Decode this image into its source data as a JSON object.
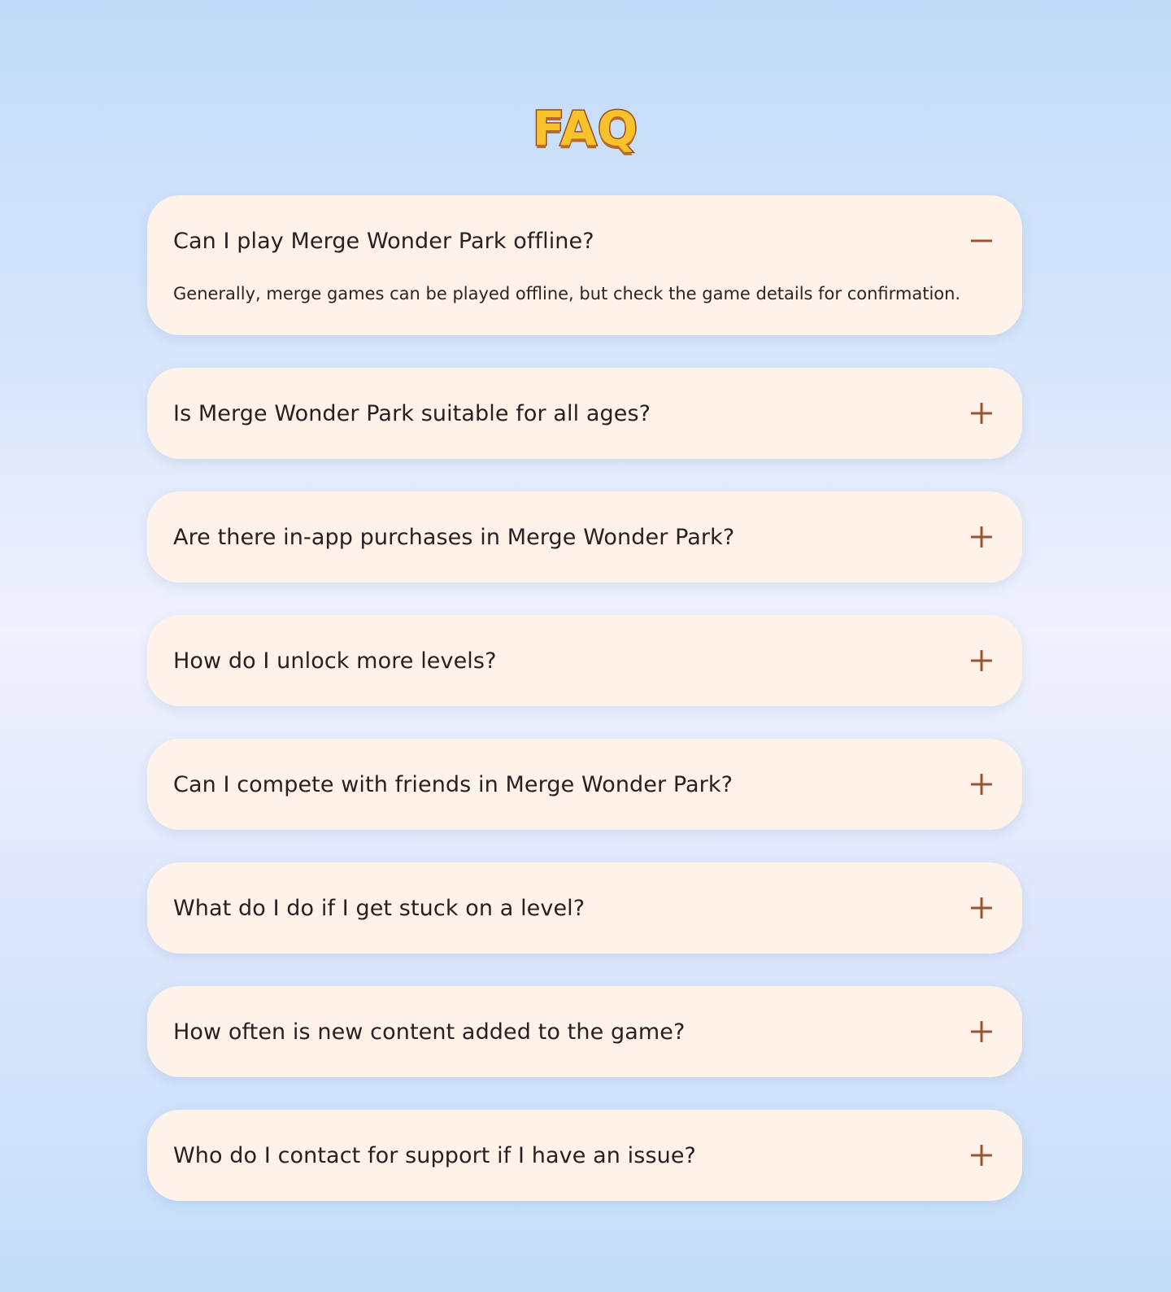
{
  "page": {
    "title": "FAQ"
  },
  "colors": {
    "card_background": "#fff2e9",
    "accent": "#a0522d",
    "title_fill": "#f7c22c",
    "title_outline": "#9a4a20"
  },
  "faq": {
    "items": [
      {
        "question": "Can I play Merge Wonder Park offline?",
        "answer": "Generally, merge games can be played offline, but check the game details for confirmation.",
        "expanded": true,
        "toggle_icon": "minus-icon"
      },
      {
        "question": "Is Merge Wonder Park suitable for all ages?",
        "expanded": false,
        "toggle_icon": "plus-icon"
      },
      {
        "question": "Are there in-app purchases in Merge Wonder Park?",
        "expanded": false,
        "toggle_icon": "plus-icon"
      },
      {
        "question": "How do I unlock more levels?",
        "expanded": false,
        "toggle_icon": "plus-icon"
      },
      {
        "question": "Can I compete with friends in Merge Wonder Park?",
        "expanded": false,
        "toggle_icon": "plus-icon"
      },
      {
        "question": "What do I do if I get stuck on a level?",
        "expanded": false,
        "toggle_icon": "plus-icon"
      },
      {
        "question": "How often is new content added to the game?",
        "expanded": false,
        "toggle_icon": "plus-icon"
      },
      {
        "question": "Who do I contact for support if I have an issue?",
        "expanded": false,
        "toggle_icon": "plus-icon"
      }
    ]
  }
}
